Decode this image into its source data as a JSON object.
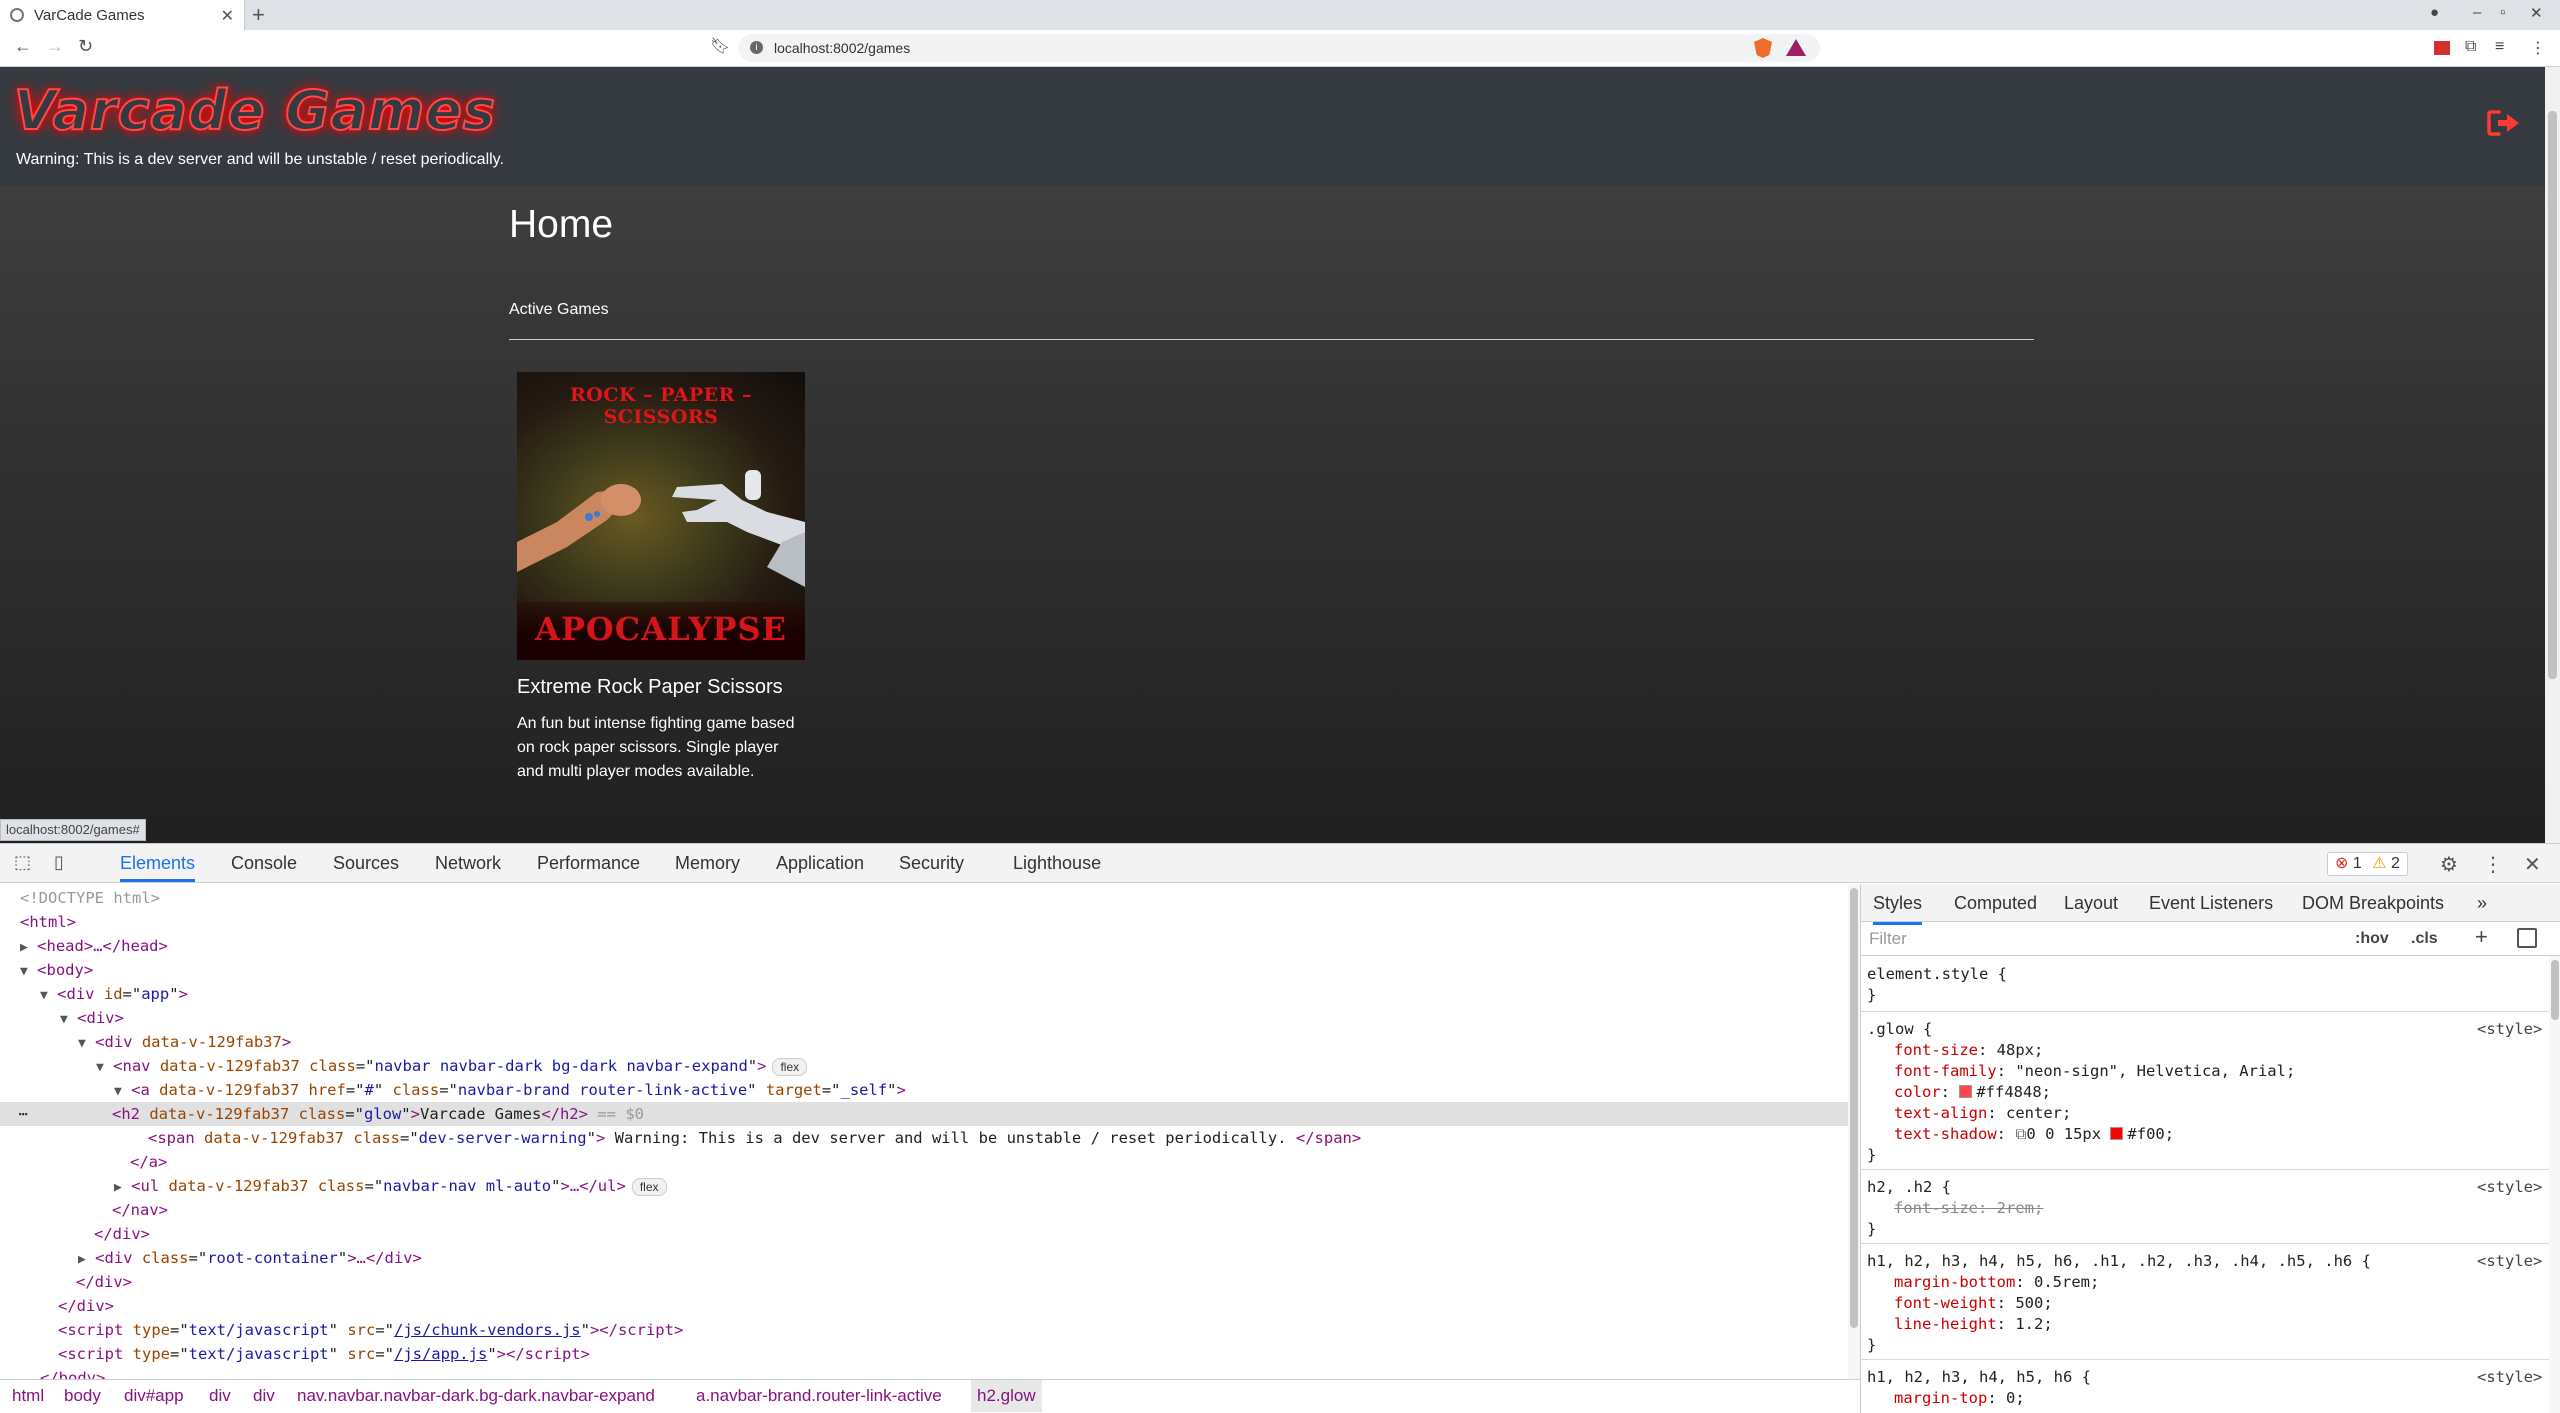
{
  "browser": {
    "tab_title": "VarCade Games",
    "url": "localhost:8002/games",
    "status_url": "localhost:8002/games#"
  },
  "site": {
    "brand": "Varcade Games",
    "dev_warning": "Warning: This is a dev server and will be unstable / reset periodically.",
    "page_title": "Home",
    "section_label": "Active Games",
    "games": [
      {
        "image_top_text": "ROCK – PAPER – SCISSORS",
        "image_bottom_text": "APOCALYPSE",
        "title": "Extreme Rock Paper Scissors",
        "description": "An fun but intense fighting game based on rock paper scissors. Single player and multi player modes available."
      }
    ]
  },
  "devtools": {
    "tabs": [
      "Elements",
      "Console",
      "Sources",
      "Network",
      "Performance",
      "Memory",
      "Application",
      "Security",
      "Lighthouse"
    ],
    "active_tab": "Elements",
    "error_count": "1",
    "warning_count": "2",
    "dom": {
      "doctype": "<!DOCTYPE html>",
      "html": "<html>",
      "head": "<head>…</head>",
      "body": "<body>",
      "div_app_tag": "div",
      "div_app_attr": "id",
      "div_app_val": "app",
      "div_plain": "<div>",
      "div_v_attr": "data-v-129fab37",
      "nav_class": "navbar navbar-dark bg-dark navbar-expand",
      "flex_badge": "flex",
      "a_href": "#",
      "a_class": "navbar-brand router-link-active",
      "a_target": "_self",
      "h2_class": "glow",
      "h2_text": "Varcade Games",
      "h2_suffix": "== $0",
      "span_class": "dev-server-warning",
      "span_text": " Warning: This is a dev server and will be unstable / reset periodically. ",
      "ul_class": "navbar-nav ml-auto",
      "root_class": "root-container",
      "script1_src": "/js/chunk-vendors.js",
      "script2_src": "/js/app.js",
      "script_type": "text/javascript"
    },
    "breadcrumbs": [
      "html",
      "body",
      "div#app",
      "div",
      "div",
      "nav.navbar.navbar-dark.bg-dark.navbar-expand",
      "a.navbar-brand.router-link-active",
      "h2.glow"
    ],
    "styles_tabs": [
      "Styles",
      "Computed",
      "Layout",
      "Event Listeners",
      "DOM Breakpoints"
    ],
    "filter_placeholder": "Filter",
    "hov": ":hov",
    "cls": ".cls",
    "rules": {
      "element_style": "element.style {",
      "close": "}",
      "source": "<style>",
      "glow_sel": ".glow {",
      "glow_props": [
        {
          "name": "font-size",
          "value": "48px;"
        },
        {
          "name": "font-family",
          "value": "\"neon-sign\", Helvetica, Arial;"
        },
        {
          "name": "color",
          "value": "#ff4848;"
        },
        {
          "name": "text-align",
          "value": "center;"
        },
        {
          "name": "text-shadow",
          "value": "0 0 15px"
        },
        {
          "name": "text-shadow-color",
          "value": "#f00;"
        }
      ],
      "h2_sel": "h2, .h2 {",
      "h2_prop": "font-size: 2rem;",
      "h_sel": "h1, h2, h3, h4, h5, h6, .h1, .h2, .h3, .h4, .h5, .h6 {",
      "h_props": [
        {
          "name": "margin-bottom",
          "value": "0.5rem;"
        },
        {
          "name": "font-weight",
          "value": "500;"
        },
        {
          "name": "line-height",
          "value": "1.2;"
        }
      ],
      "h_sel2": "h1, h2, h3, h4, h5, h6 {",
      "h2_props": [
        {
          "name": "margin-top",
          "value": "0;"
        }
      ]
    },
    "colors": {
      "glow": "#ff4848",
      "shadow": "#f00"
    }
  }
}
